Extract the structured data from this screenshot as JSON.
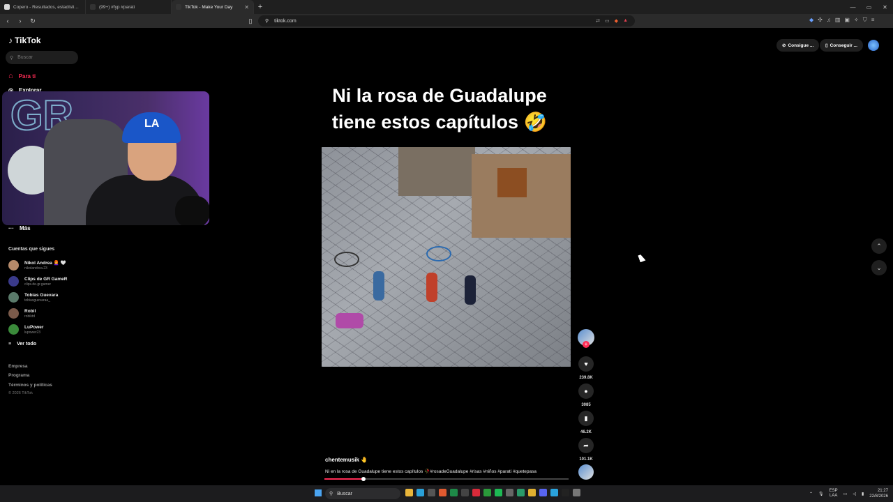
{
  "browser": {
    "tabs": [
      {
        "title": "Copero - Resultados, estadísticas, an",
        "favicon_color": "#d9d9d9"
      },
      {
        "title": "(99+) #fyp #parati",
        "favicon_color": "#111111"
      },
      {
        "title": "TikTok - Make Your Day",
        "favicon_color": "#111111",
        "active": true
      }
    ],
    "new_tab": "+",
    "url": "tiktok.com",
    "window_controls": [
      "—",
      "▭",
      "✕"
    ]
  },
  "sidebar": {
    "logo": "TikTok",
    "search_placeholder": "Buscar",
    "nav": [
      {
        "label": "Para ti",
        "icon": "home-icon",
        "active": true
      },
      {
        "label": "Explorar",
        "icon": "compass-icon"
      },
      {
        "label": "Más",
        "icon": "more-icon"
      }
    ],
    "following_title": "Cuentas que sigues",
    "following": [
      {
        "name": "Nikol Andrea 👩‍🦰 🤍",
        "handle": "nikolandrea.23",
        "color": "#b58a6a"
      },
      {
        "name": "Clips de GR GameR",
        "handle": "clips.de.gr.gamer",
        "color": "#3a3a8a"
      },
      {
        "name": "Tobias Guevara",
        "handle": "tobiasguevaraa_",
        "color": "#5a7a6a"
      },
      {
        "name": "Robil",
        "handle": "robiktd",
        "color": "#7a5a4a"
      },
      {
        "name": "LuPower",
        "handle": "lupower23",
        "color": "#3a8a3a"
      }
    ],
    "see_all": "Ver todo",
    "footer": [
      "Empresa",
      "Programa",
      "Términos y políticas"
    ],
    "copyright": "© 2026 TikTok"
  },
  "webcam": {
    "neon_text": "GR",
    "cap_text": "LA"
  },
  "video": {
    "caption_line1": "Ni la rosa de Guadalupe",
    "caption_line2": "tiene estos capítulos 🤣",
    "author": "chentemusik 🤚",
    "description": "Ni en la rosa de Guadalupe tiene estos capítulos 🥀#rosadeGuadalupe #risas #niños #parati #quetepasa",
    "progress": 0.16
  },
  "actions": {
    "likes": "239.8K",
    "comments": "3085",
    "saves": "46.2K",
    "shares": "101.1K"
  },
  "topbar": {
    "btn1": "Consigue ...",
    "btn2": "Conseguir ..."
  },
  "taskbar": {
    "search": "Buscar",
    "lang_line1": "ESP",
    "lang_line2": "LAA",
    "time": "21:27",
    "date": "22/8/2026"
  }
}
